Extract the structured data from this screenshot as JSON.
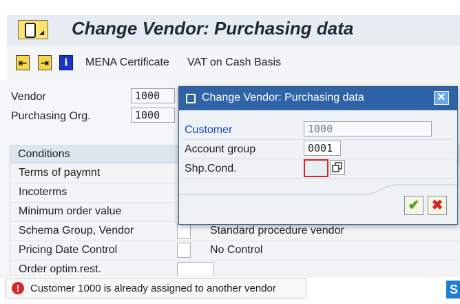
{
  "header": {
    "title": "Change Vendor: Purchasing data"
  },
  "toolbar": {
    "items": [
      {
        "label": "MENA Certificate"
      },
      {
        "label": "VAT on Cash Basis"
      }
    ],
    "icons": [
      "previous-screen-icon",
      "next-screen-icon",
      "info-icon"
    ]
  },
  "main": {
    "vendor": {
      "label": "Vendor",
      "value": "1000"
    },
    "purchasing_org": {
      "label": "Purchasing Org.",
      "value": "1000"
    },
    "conditions": {
      "title": "Conditions",
      "rows": [
        {
          "label": "Terms of paymnt",
          "desc": ""
        },
        {
          "label": "Incoterms",
          "desc": ""
        },
        {
          "label": "Minimum order value",
          "desc": ""
        },
        {
          "label": "Schema Group, Vendor",
          "desc": "Standard procedure vendor"
        },
        {
          "label": "Pricing Date Control",
          "desc": "No Control"
        },
        {
          "label": "Order optim.rest.",
          "desc": ""
        }
      ]
    }
  },
  "dialog": {
    "title": "Change Vendor: Purchasing data",
    "fields": {
      "customer": {
        "label": "Customer",
        "value": "1000"
      },
      "account_group": {
        "label": "Account group",
        "value": "0001"
      },
      "shp_cond": {
        "label": "Shp.Cond.",
        "value": ""
      }
    }
  },
  "status": {
    "message": "Customer 1000 is already assigned to another vendor",
    "type": "error"
  },
  "colors": {
    "dialog_title": "#2f63a8",
    "customer_label": "#1747c9",
    "error": "#d72929"
  }
}
